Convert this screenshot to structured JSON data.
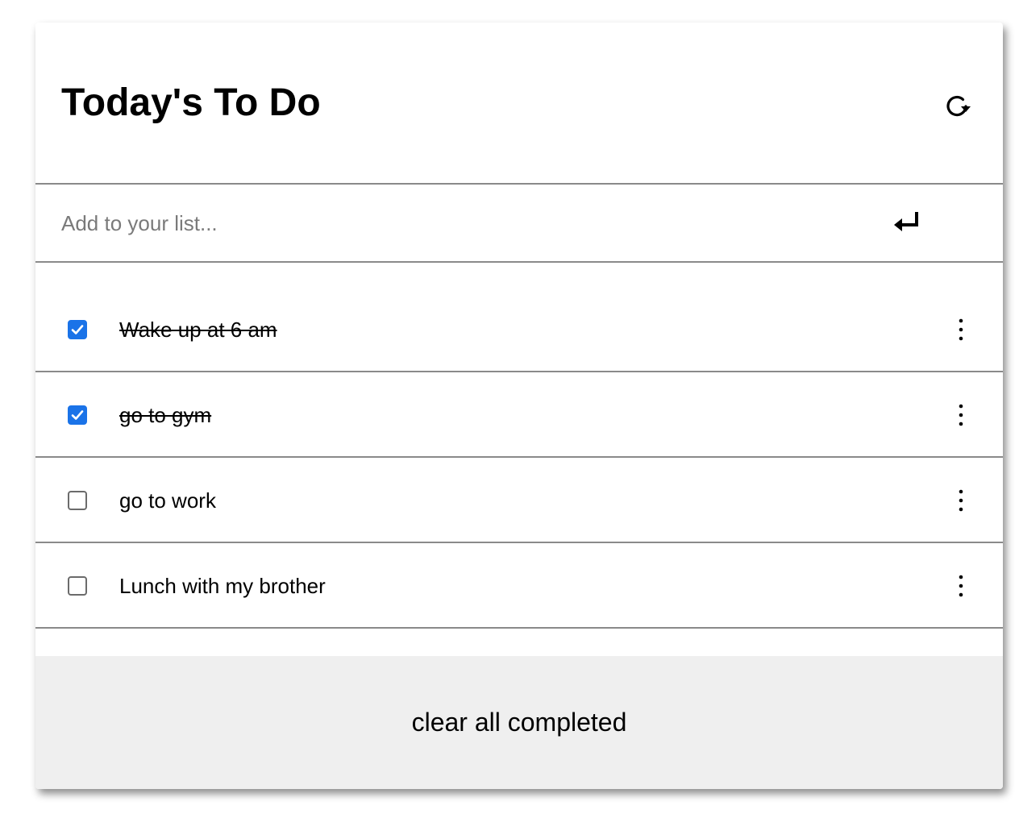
{
  "header": {
    "title": "Today's To Do",
    "refresh_icon": "refresh-icon"
  },
  "add": {
    "placeholder": "Add to your list...",
    "value": "",
    "submit_icon": "enter-icon"
  },
  "todos": [
    {
      "text": "Wake up at 6 am",
      "completed": true
    },
    {
      "text": "go to gym",
      "completed": true
    },
    {
      "text": "go to work",
      "completed": false
    },
    {
      "text": "Lunch with my brother",
      "completed": false
    }
  ],
  "footer": {
    "clear_label": "clear all completed"
  },
  "colors": {
    "checkbox_checked": "#1a73e8",
    "divider": "#8a8a8a",
    "footer_bg": "#efefef",
    "placeholder": "#7a7a7a"
  }
}
